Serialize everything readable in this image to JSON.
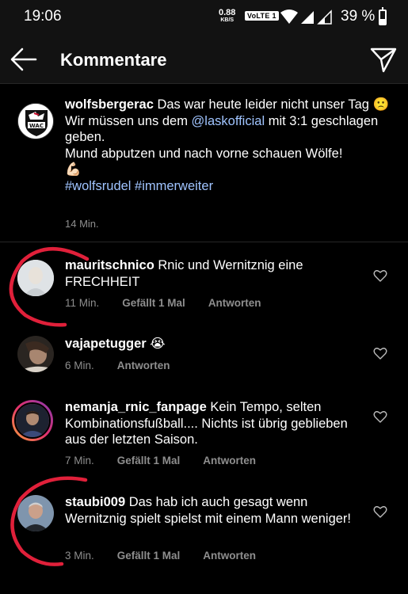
{
  "status_bar": {
    "time": "19:06",
    "net_speed_value": "0.88",
    "net_speed_unit": "KB/S",
    "volte": "VoLTE 1",
    "battery_percent": "39 %",
    "battery_level": 0.39
  },
  "header": {
    "title": "Kommentare",
    "back_icon": "arrow-left-icon",
    "send_icon": "paper-plane-icon"
  },
  "caption": {
    "username": "wolfsbergerac",
    "text_1": " Das war heute leider nicht unser Tag 🙁",
    "text_2": "Wir müssen uns dem ",
    "mention": "@laskofficial",
    "text_3": " mit 3:1 geschlagen geben.",
    "text_4": "Mund abputzen und nach vorne schauen Wölfe!",
    "emoji": "💪🏻",
    "hashtags": "#wolfsrudel #immerweiter",
    "time": "14 Min."
  },
  "comments": [
    {
      "username": "mauritschnico",
      "text": " Rnic und Wernitznig eine FRECHHEIT",
      "time": "11 Min.",
      "likes": "Gefällt 1 Mal",
      "reply": "Antworten"
    },
    {
      "username": "vajapetugger",
      "text": " 😭",
      "time": "6 Min.",
      "likes": "",
      "reply": "Antworten"
    },
    {
      "username": "nemanja_rnic_fanpage",
      "text": " Kein Tempo, selten Kombinationsfußball.... Nichts ist übrig geblieben aus der letzten Saison.",
      "time": "7 Min.",
      "likes": "Gefällt 1 Mal",
      "reply": "Antworten"
    },
    {
      "username": "staubi009",
      "text": " Das hab ich auch gesagt wenn Wernitznig spielt spielst mit einem Mann weniger!",
      "time": "3 Min.",
      "likes": "Gefällt 1 Mal",
      "reply": "Antworten"
    }
  ],
  "colors": {
    "background": "#000000",
    "bar": "#121212",
    "secondary_text": "#8e8e8e",
    "link": "#a0c4ff",
    "annotation": "#e0203a"
  }
}
